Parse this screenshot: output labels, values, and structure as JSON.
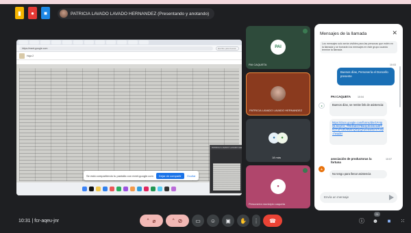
{
  "presenter": {
    "label": "PATRICIA LAVADO LAVADO HERNANDEZ (Presentando y anotando)"
  },
  "stage": {
    "address_bar": "https://meet.google.com",
    "doc_title": "Hoja 2",
    "search_placeholder": "Escribe para buscar",
    "share_banner": "Se está compartiendo tu pantalla con meet.google.com",
    "stop_share_label": "Dejar de compartir",
    "hide_label": "Ocultar",
    "pip_title": "PATRICIA LAVADO LAVADO HERNANDEZ"
  },
  "tiles": [
    {
      "name": "PAI CAQUETA",
      "avatar_text": "PAI",
      "bg": "#2e4b3b"
    },
    {
      "name": "PATRICIA LAVADO LAVADO HERNANDEZ",
      "avatar_text": "",
      "bg": "#8a3a1e"
    },
    {
      "name": "18 más",
      "avatar_text": "",
      "bg": "#353a3f"
    },
    {
      "name": "Personería municipio caqueta",
      "avatar_text": "",
      "bg": "#b0466c"
    }
  ],
  "chat": {
    "title": "Mensajes de la llamada",
    "info_text": "Los mensajes solo serán visibles para las personas que estén en la llamada y se borrarán los mensajes en este grupo cuando termine la llamada",
    "messages": [
      {
        "sender": "",
        "time": "10:03",
        "text": "Buenos días, Personería el Doncello presente",
        "mine": true
      },
      {
        "sender": "PAI CAQUETA",
        "time": "10:04",
        "text": "Buenos días, se remite link de asistencia:",
        "link": "https://docs.google.com/forms/d/e/1FAIpQLSeyCH_TRKDdnCFBk4yJm4Kcsd0T_hOTuPVBV9tWhQrDpQzw/viewform?usp=header"
      },
      {
        "sender": "asociación de productoras la fortuna",
        "time": "10:07",
        "text": "No tengo para llenar asistencia"
      }
    ],
    "input_placeholder": "Envía un mensaje"
  },
  "footer": {
    "time": "10:31",
    "separator": "|",
    "meeting_code": "fcr-aqeu-jnr",
    "participant_count": "21"
  },
  "colors": {
    "background": "#1e1f22",
    "accent": "#1a73e8",
    "hangup": "#ea4335",
    "muted_button": "#f2b8b5"
  },
  "icons": [
    "mic-off-icon",
    "camera-off-icon",
    "captions-icon",
    "emoji-icon",
    "present-icon",
    "raise-hand-icon",
    "more-icon",
    "hangup-icon",
    "info-icon",
    "people-icon",
    "chat-icon",
    "activities-icon"
  ]
}
